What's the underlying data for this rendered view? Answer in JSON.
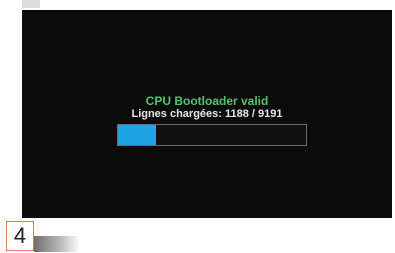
{
  "screen": {
    "title": "CPU Bootloader valid",
    "lines_text": "Lignes chargées: 1188 / 9191",
    "progress": {
      "loaded": 1188,
      "total": 9191,
      "fraction": 0.2
    }
  },
  "step": {
    "number": "4"
  },
  "colors": {
    "title": "#52c46a",
    "text": "#e8e8e8",
    "progress_fill": "#1fa3e6",
    "screen_bg": "#0b0b0b",
    "step_border": "#e07a55"
  }
}
